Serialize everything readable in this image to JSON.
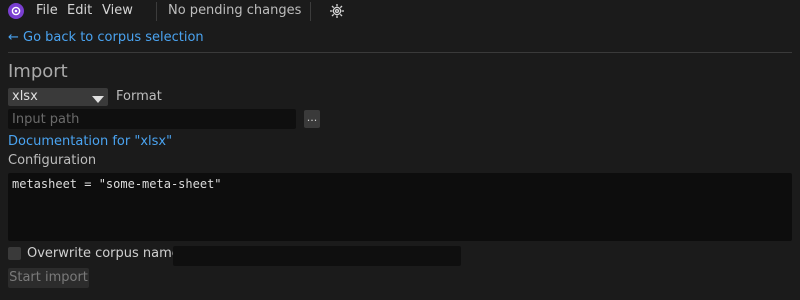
{
  "menubar": {
    "app_icon": "app-logo-icon",
    "items": [
      {
        "label": "File"
      },
      {
        "label": "Edit"
      },
      {
        "label": "View"
      }
    ],
    "status": "No pending changes",
    "settings_icon": "gear-icon"
  },
  "nav": {
    "back_link": "← Go back to corpus selection"
  },
  "import": {
    "heading": "Import",
    "format_value": "xlsx",
    "format_label": "Format",
    "input_path_placeholder": "Input path",
    "input_path_value": "",
    "browse_label": "...",
    "doc_link": "Documentation for \"xlsx\"",
    "config_label": "Configuration",
    "config_value": "metasheet = \"some-meta-sheet\"",
    "overwrite_checked": false,
    "overwrite_label": "Overwrite corpus name",
    "corpus_name_value": "",
    "start_button": "Start import"
  },
  "colors": {
    "background": "#1b1b1b",
    "link": "#4aa3f0",
    "accent": "#7a3fd1"
  }
}
